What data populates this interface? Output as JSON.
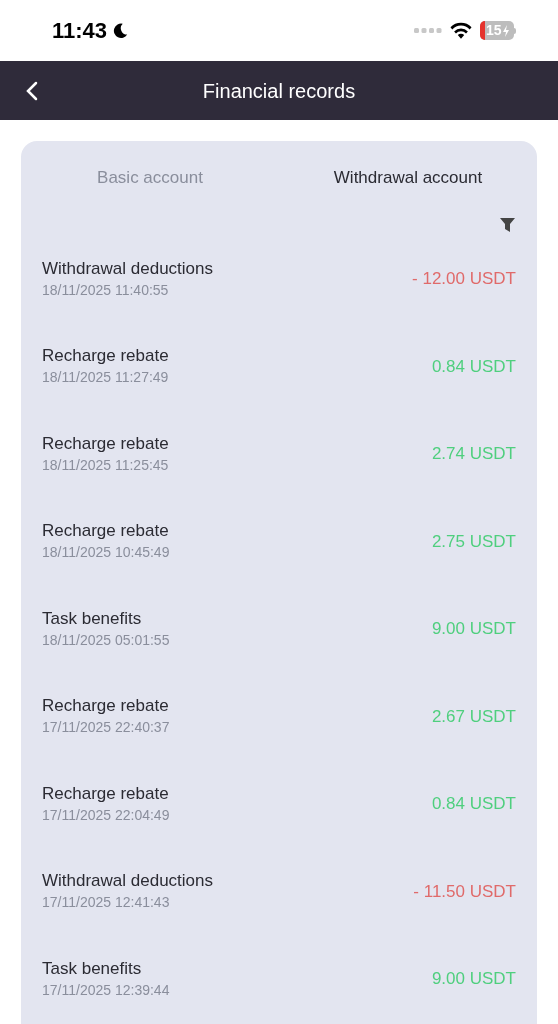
{
  "status_bar": {
    "time": "11:43",
    "battery": "15"
  },
  "header": {
    "title": "Financial records"
  },
  "tabs": [
    {
      "label": "Basic account",
      "selected": false
    },
    {
      "label": "Withdrawal account",
      "selected": true
    }
  ],
  "records": [
    {
      "title": "Withdrawal deductions",
      "date": "18/11/2025 11:40:55",
      "amount": "- 12.00 USDT",
      "kind": "debit"
    },
    {
      "title": "Recharge rebate",
      "date": "18/11/2025 11:27:49",
      "amount": "0.84 USDT",
      "kind": "credit"
    },
    {
      "title": "Recharge rebate",
      "date": "18/11/2025 11:25:45",
      "amount": "2.74 USDT",
      "kind": "credit"
    },
    {
      "title": "Recharge rebate",
      "date": "18/11/2025 10:45:49",
      "amount": "2.75 USDT",
      "kind": "credit"
    },
    {
      "title": "Task benefits",
      "date": "18/11/2025 05:01:55",
      "amount": "9.00 USDT",
      "kind": "credit"
    },
    {
      "title": "Recharge rebate",
      "date": "17/11/2025 22:40:37",
      "amount": "2.67 USDT",
      "kind": "credit"
    },
    {
      "title": "Recharge rebate",
      "date": "17/11/2025 22:04:49",
      "amount": "0.84 USDT",
      "kind": "credit"
    },
    {
      "title": "Withdrawal deductions",
      "date": "17/11/2025 12:41:43",
      "amount": "- 11.50 USDT",
      "kind": "debit"
    },
    {
      "title": "Task benefits",
      "date": "17/11/2025 12:39:44",
      "amount": "9.00 USDT",
      "kind": "credit"
    }
  ]
}
